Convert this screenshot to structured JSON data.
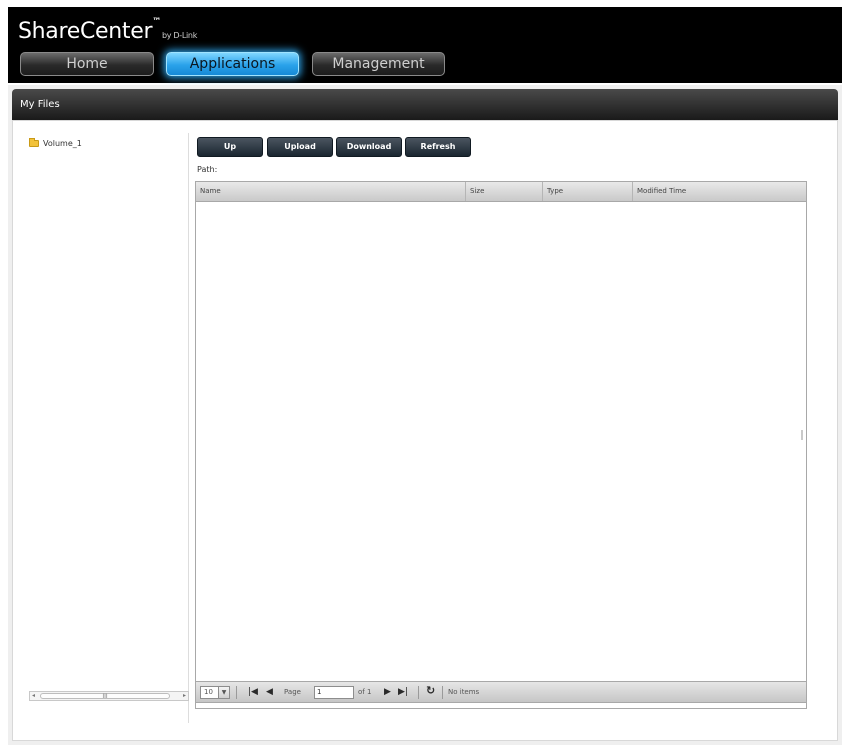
{
  "header": {
    "brand": "ShareCenter",
    "brand_tm": "™",
    "brand_by": "by D-Link",
    "tabs": [
      {
        "label": "Home",
        "active": false
      },
      {
        "label": "Applications",
        "active": true
      },
      {
        "label": "Management",
        "active": false
      }
    ]
  },
  "panel": {
    "title": "My Files"
  },
  "tree": {
    "items": [
      {
        "label": "Volume_1",
        "icon": "folder-icon"
      }
    ],
    "scroll_thumb": "III"
  },
  "toolbar": {
    "up_label": "Up",
    "upload_label": "Upload",
    "download_label": "Download",
    "refresh_label": "Refresh",
    "path_label": "Path:"
  },
  "grid": {
    "columns": [
      "Name",
      "Size",
      "Type",
      "Modified Time"
    ]
  },
  "pager": {
    "page_size": "10",
    "page_label": "Page",
    "page_value": "1",
    "of_label": "of 1",
    "status": "No items"
  },
  "colors": {
    "active_tab": "#2aa2ea",
    "header_bg": "#000000",
    "button_bg": "#1a2630"
  }
}
